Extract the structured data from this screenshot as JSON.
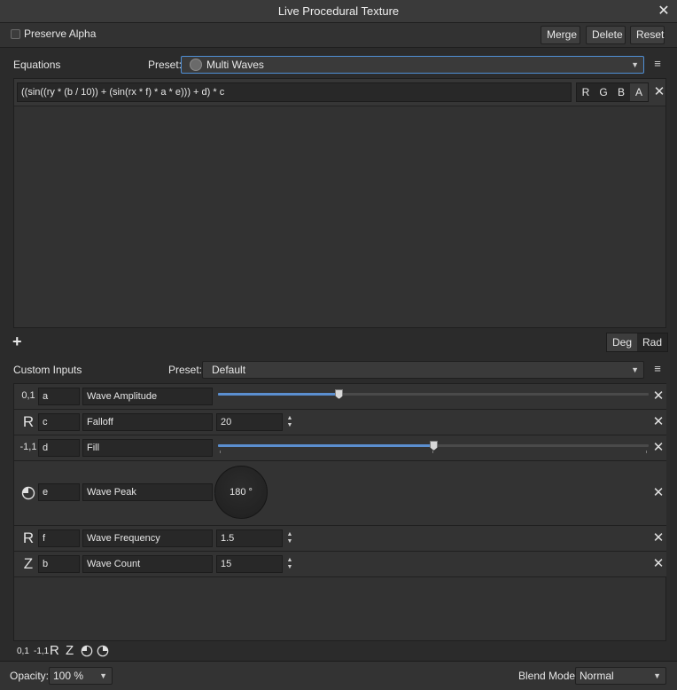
{
  "window": {
    "title": "Live Procedural Texture"
  },
  "top": {
    "preserve_alpha_label": "Preserve Alpha",
    "merge_label": "Merge",
    "delete_label": "Delete",
    "reset_label": "Reset"
  },
  "equations": {
    "label": "Equations",
    "preset_label": "Preset:",
    "preset_value": "Multi Waves",
    "expression": "((sin((ry * (b / 10)) + (sin(rx * f) * a * e))) + d) * c",
    "channels": [
      "R",
      "G",
      "B",
      "A"
    ],
    "active_channel": "A",
    "add_label": "+",
    "deg_label": "Deg",
    "rad_label": "Rad",
    "active_unit": "Deg"
  },
  "custom_inputs": {
    "label": "Custom Inputs",
    "preset_label": "Preset:",
    "preset_value": "Default",
    "rows": [
      {
        "type": "range01",
        "type_label": "0,1",
        "var": "a",
        "name": "Wave Amplitude",
        "level": 0.28
      },
      {
        "type": "real",
        "type_label": "R",
        "var": "c",
        "name": "Falloff",
        "value": "20"
      },
      {
        "type": "range-11",
        "type_label": "-1,1",
        "var": "d",
        "name": "Fill",
        "level": 0.5
      },
      {
        "type": "angle",
        "type_label": "",
        "var": "e",
        "name": "Wave Peak",
        "value": "180 °"
      },
      {
        "type": "real",
        "type_label": "R",
        "var": "f",
        "name": "Wave Frequency",
        "value": "1.5"
      },
      {
        "type": "integer",
        "type_label": "Z",
        "var": "b",
        "name": "Wave Count",
        "value": "15"
      }
    ],
    "add_types": [
      "0,1",
      "-1,1",
      "R",
      "Z"
    ]
  },
  "footer": {
    "opacity_label": "Opacity:",
    "opacity_value": "100 %",
    "blend_label": "Blend Mode:",
    "blend_value": "Normal"
  },
  "colors": {
    "accent": "#5b8fd0",
    "background": "#2b2b2b",
    "panel": "#323232"
  }
}
